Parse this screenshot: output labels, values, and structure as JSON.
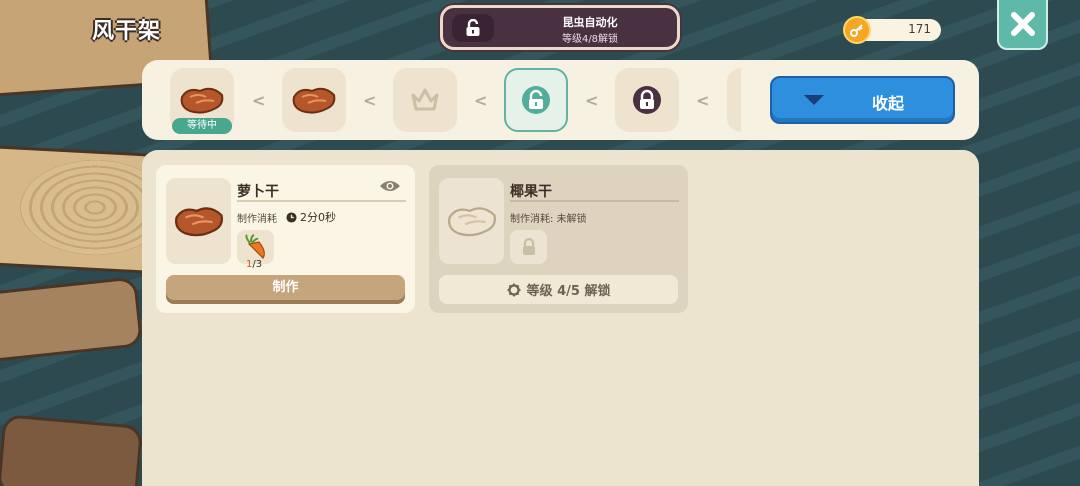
{
  "header": {
    "title": "风干架"
  },
  "unlock_banner": {
    "title": "昆虫自动化",
    "subtitle": "等级4/8解锁",
    "icon": "lock-open-icon"
  },
  "currency": {
    "icon": "key-coin-icon",
    "amount": "171"
  },
  "close": {
    "icon": "close-x-icon"
  },
  "queue": {
    "slots": [
      {
        "state": "waiting",
        "item_icon": "dried-carrot-icon",
        "badge": "等待中"
      },
      {
        "state": "filled",
        "item_icon": "dried-carrot-icon"
      },
      {
        "state": "empty",
        "item_icon": "crown-icon"
      },
      {
        "state": "unlocked-selected",
        "item_icon": "lock-open-icon"
      },
      {
        "state": "locked",
        "item_icon": "lock-icon"
      }
    ],
    "separator_icon": "chevron-left-icon",
    "collapse_label": "收起"
  },
  "recipes": [
    {
      "name": "萝卜干",
      "cost_label": "制作消耗",
      "time": "2分0秒",
      "ingredient": {
        "icon": "carrot-icon",
        "have": "1",
        "need": "/3"
      },
      "craft_label": "制作",
      "locked": false
    },
    {
      "name": "椰果干",
      "cost_label": "制作消耗: 未解锁",
      "unlock_label": "等级 4/5 解锁",
      "locked": true
    }
  ],
  "colors": {
    "accent_teal": "#5fb9a9",
    "button_blue": "#2e8fde",
    "banner_plum": "#4a3142",
    "coin": "#f5a623"
  }
}
